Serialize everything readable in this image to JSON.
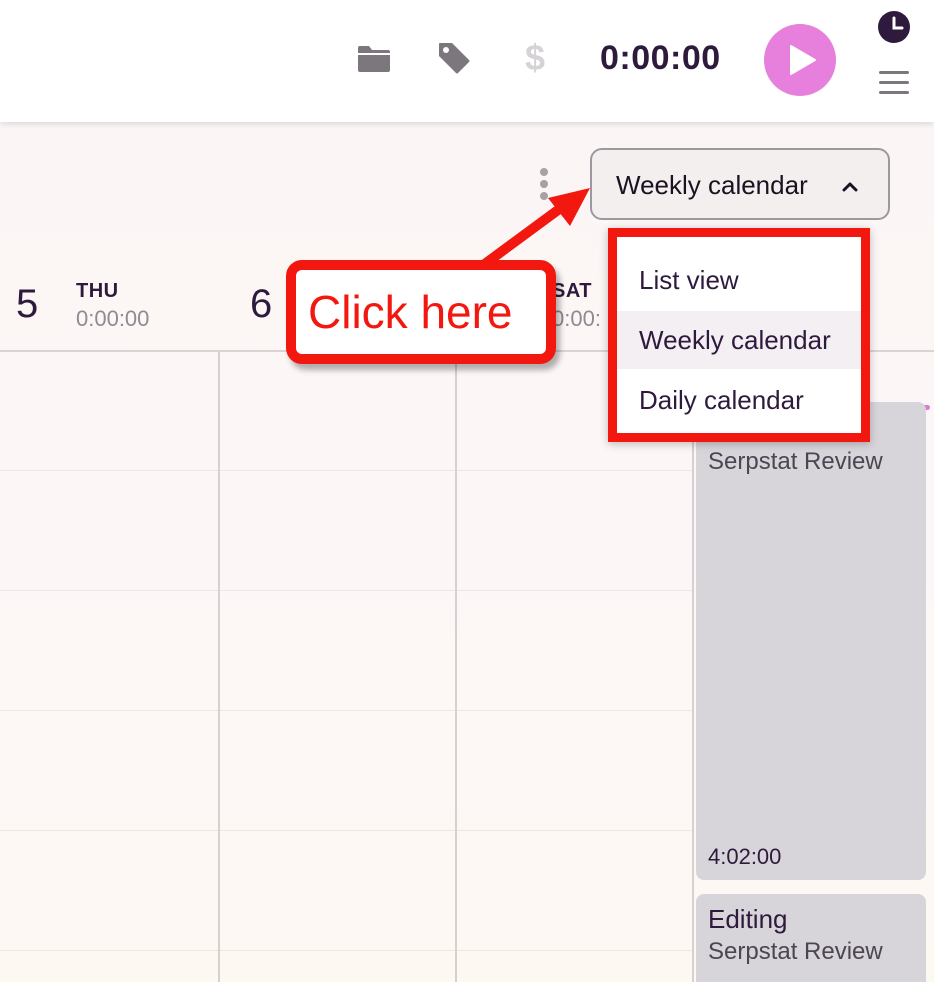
{
  "toolbar": {
    "timer": "0:00:00",
    "dollar_glyph": "$",
    "icons": [
      "folder-icon",
      "tag-icon",
      "dollar-icon",
      "play-icon",
      "clock-icon",
      "hamburger-menu-icon"
    ],
    "accent_color": "#e77fdc"
  },
  "view_selector": {
    "current": "Weekly calendar",
    "options": [
      "List view",
      "Weekly calendar",
      "Daily calendar"
    ]
  },
  "days": [
    {
      "number": "5",
      "name": "THU",
      "total": "0:00:00"
    },
    {
      "number": "6",
      "name": "",
      "total": ""
    },
    {
      "number": "",
      "name": "SAT",
      "total": "0:00:"
    }
  ],
  "events": [
    {
      "project": "Serpstat Review",
      "duration": "4:02:00"
    },
    {
      "description": "Editing",
      "project": "Serpstat Review"
    }
  ],
  "annotation": {
    "callout_text": "Click here",
    "callout_color": "#f21810"
  }
}
